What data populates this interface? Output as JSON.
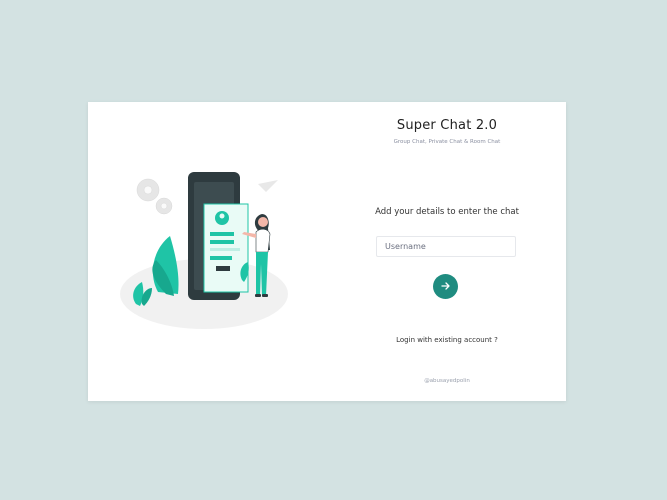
{
  "app": {
    "title": "Super Chat 2.0",
    "subtitle": "Group Chat, Private Chat & Room Chat"
  },
  "form": {
    "prompt": "Add your details to enter the chat",
    "username_placeholder": "Username",
    "username_value": "",
    "submit_icon": "arrow-right-icon"
  },
  "links": {
    "login_existing": "Login with existing account ?"
  },
  "footer": {
    "credit": "@abusayedpolin"
  },
  "colors": {
    "background": "#d3e2e2",
    "card": "#ffffff",
    "accent": "#1f8c80",
    "illustration_green": "#1fc4a6",
    "phone_dark": "#2e3b3f"
  }
}
